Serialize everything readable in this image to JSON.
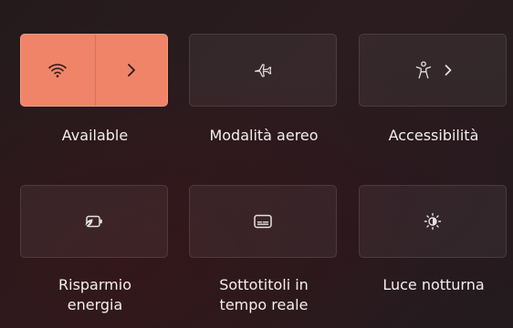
{
  "quick_settings": {
    "tiles": [
      {
        "label": "Available",
        "icon": "wifi-icon",
        "secondary_icon": "chevron-right-icon",
        "active": true
      },
      {
        "label": "Modalità aereo",
        "icon": "airplane-icon",
        "active": false
      },
      {
        "label": "Accessibilità",
        "icon": "accessibility-icon",
        "secondary_icon": "chevron-right-icon",
        "active": false
      },
      {
        "label": "Risparmio energia",
        "label_line1": "Risparmio",
        "label_line2": "energia",
        "icon": "battery-saver-icon",
        "active": false
      },
      {
        "label": "Sottotitoli in tempo reale",
        "label_line1": "Sottotitoli in",
        "label_line2": "tempo reale",
        "icon": "live-captions-icon",
        "active": false
      },
      {
        "label": "Luce notturna",
        "icon": "night-light-icon",
        "active": false
      }
    ]
  },
  "colors": {
    "accent": "#f08468",
    "tile_bg": "rgba(255,255,255,0.055)",
    "text": "#f2eeee"
  }
}
